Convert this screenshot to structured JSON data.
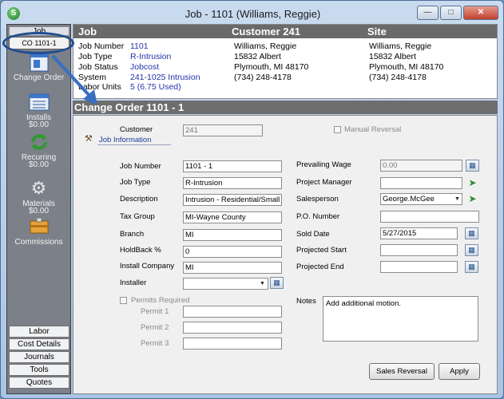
{
  "window": {
    "title": "Job - 1101 (Williams, Reggie)",
    "min_glyph": "—",
    "max_glyph": "□",
    "close_glyph": "✕"
  },
  "sidebar": {
    "job_label": "Job",
    "co_label": "CO 1101-1",
    "items": [
      {
        "label": "Change Order",
        "amount": ""
      },
      {
        "label": "Installs",
        "amount": "$0.00"
      },
      {
        "label": "Recurring",
        "amount": "$0.00"
      },
      {
        "label": "Materials",
        "amount": "$0.00"
      },
      {
        "label": "Commissions",
        "amount": ""
      }
    ],
    "bottom": [
      "Labor",
      "Cost Details",
      "Journals",
      "Tools",
      "Quotes"
    ]
  },
  "header": {
    "job_title": "Job",
    "customer_title": "Customer 241",
    "site_title": "Site",
    "job_fields": [
      {
        "label": "Job Number",
        "value": "1101"
      },
      {
        "label": "Job Type",
        "value": "R-Intrusion"
      },
      {
        "label": "Job Status",
        "value": "Jobcost"
      },
      {
        "label": "System",
        "value": "241-1025 Intrusion"
      },
      {
        "label": "Labor Units",
        "value": "5 (6.75 Used)"
      }
    ],
    "customer_lines": [
      "Williams, Reggie",
      "15832 Albert",
      "Plymouth, MI 48170",
      "(734) 248-4178"
    ],
    "site_lines": [
      "Williams, Reggie",
      "15832 Albert",
      "Plymouth, MI 48170",
      "(734) 248-4178"
    ]
  },
  "change_order": {
    "title": "Change Order 1101 - 1"
  },
  "form": {
    "customer_label": "Customer",
    "customer_value": "241",
    "manual_reversal_label": "Manual Reversal",
    "job_info_link": "Job Information",
    "left": [
      {
        "label": "Job Number",
        "value": "1101 - 1"
      },
      {
        "label": "Job Type",
        "value": "R-Intrusion"
      },
      {
        "label": "Description",
        "value": "Intrusion - Residential/Small Co"
      },
      {
        "label": "Tax Group",
        "value": "MI-Wayne County"
      },
      {
        "label": "Branch",
        "value": "MI"
      },
      {
        "label": "HoldBack  %",
        "value": "0"
      },
      {
        "label": "Install Company",
        "value": "MI"
      },
      {
        "label": "Installer",
        "value": ""
      }
    ],
    "right": [
      {
        "label": "Prevailing Wage",
        "value": "0.00"
      },
      {
        "label": "Project Manager",
        "value": ""
      },
      {
        "label": "Salesperson",
        "value": "George.McGee"
      },
      {
        "label": "P.O. Number",
        "value": ""
      },
      {
        "label": "Sold Date",
        "value": "5/27/2015"
      },
      {
        "label": "Projected Start",
        "value": ""
      },
      {
        "label": "Projected End",
        "value": ""
      }
    ],
    "permits_required_label": "Permits Required",
    "permit_labels": [
      "Permit 1",
      "Permit 2",
      "Permit 3"
    ],
    "notes_label": "Notes",
    "notes_value": "Add additional motion.",
    "sales_reversal_label": "Sales Reversal",
    "apply_label": "Apply"
  },
  "icons": {
    "app": "s-circle-icon",
    "change_order": "document-window-icon",
    "installs": "list-window-icon",
    "recurring": "recycle-arrows-icon",
    "materials": "gear-icon",
    "commissions": "cash-box-icon",
    "calendar": "calendar-icon",
    "go": "green-arrow-icon",
    "hammer": "hammer-icon"
  },
  "colors": {
    "link_blue": "#2233aa",
    "header_bar": "#6a6a6a",
    "annotation": "#1f4e93"
  }
}
